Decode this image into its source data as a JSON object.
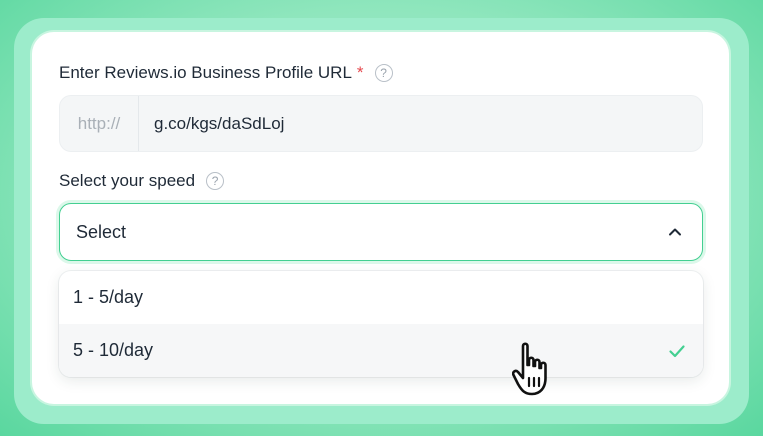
{
  "form": {
    "url_label": "Enter Reviews.io Business Profile URL",
    "required_mark": "*",
    "help_glyph": "?",
    "url_prefix": "http://",
    "url_value": "g.co/kgs/daSdLoj",
    "speed_label": "Select your speed",
    "select_value": "Select",
    "options": [
      {
        "label": "1 - 5/day",
        "selected": false
      },
      {
        "label": "5 - 10/day",
        "selected": true
      }
    ]
  },
  "colors": {
    "accent": "#43cf91",
    "background": "#5fd9a4",
    "required": "#e5484d"
  },
  "icons": {
    "help": "question-circle-icon",
    "chevron": "chevron-up-icon",
    "check": "checkmark-icon",
    "cursor": "hand-pointer-cursor-icon"
  }
}
